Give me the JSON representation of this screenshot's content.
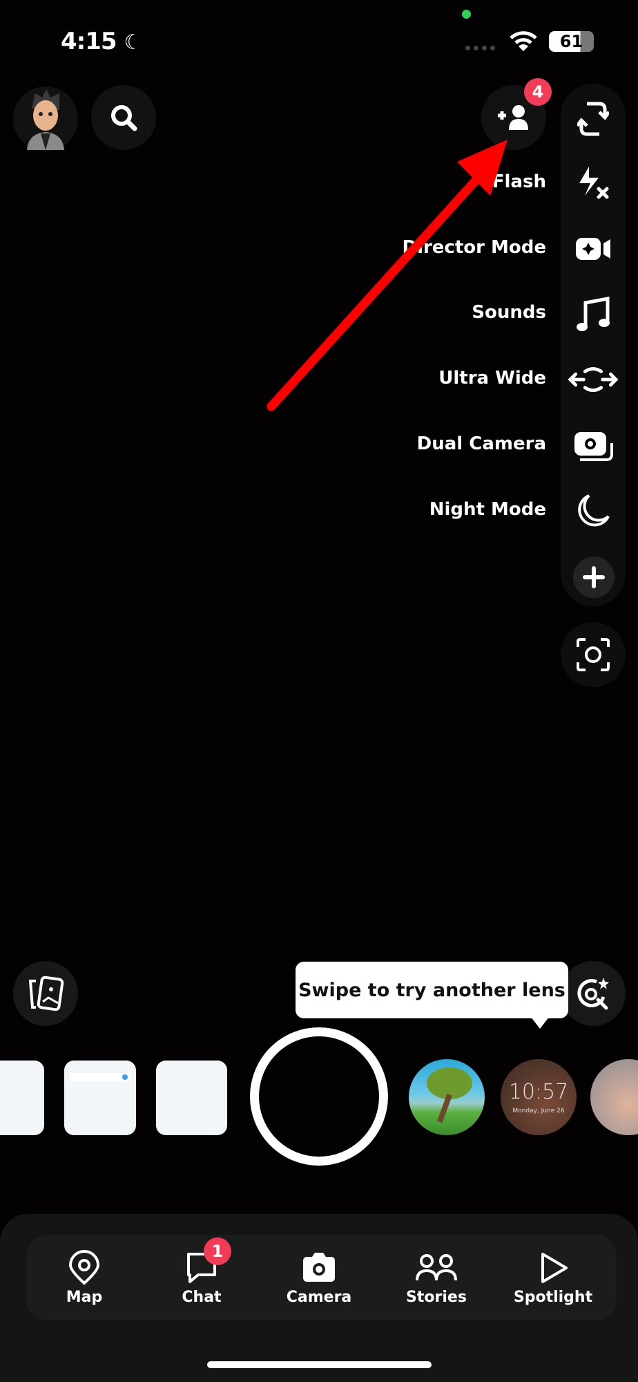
{
  "status_bar": {
    "time": "4:15",
    "battery": "61"
  },
  "top": {
    "friend_requests_badge": "4"
  },
  "camera_tools": [
    {
      "label": "",
      "icon": "flip-camera-icon"
    },
    {
      "label": "Flash",
      "icon": "flash-off-icon"
    },
    {
      "label": "Director Mode",
      "icon": "director-mode-icon"
    },
    {
      "label": "Sounds",
      "icon": "music-note-icon"
    },
    {
      "label": "Ultra Wide",
      "icon": "ultra-wide-icon"
    },
    {
      "label": "Dual Camera",
      "icon": "dual-camera-icon"
    },
    {
      "label": "Night Mode",
      "icon": "moon-icon"
    }
  ],
  "tooltip": "Swipe to try another lens",
  "lens_preview": {
    "clock": "10:57",
    "date": "Monday, June 26"
  },
  "nav": {
    "items": [
      {
        "label": "Map",
        "icon": "map-pin-icon"
      },
      {
        "label": "Chat",
        "icon": "chat-icon",
        "badge": "1"
      },
      {
        "label": "Camera",
        "icon": "camera-icon"
      },
      {
        "label": "Stories",
        "icon": "stories-icon"
      },
      {
        "label": "Spotlight",
        "icon": "spotlight-play-icon"
      }
    ]
  },
  "colors": {
    "accent_badge": "#f23c57",
    "arrow": "#ff0000",
    "background": "#040102"
  }
}
